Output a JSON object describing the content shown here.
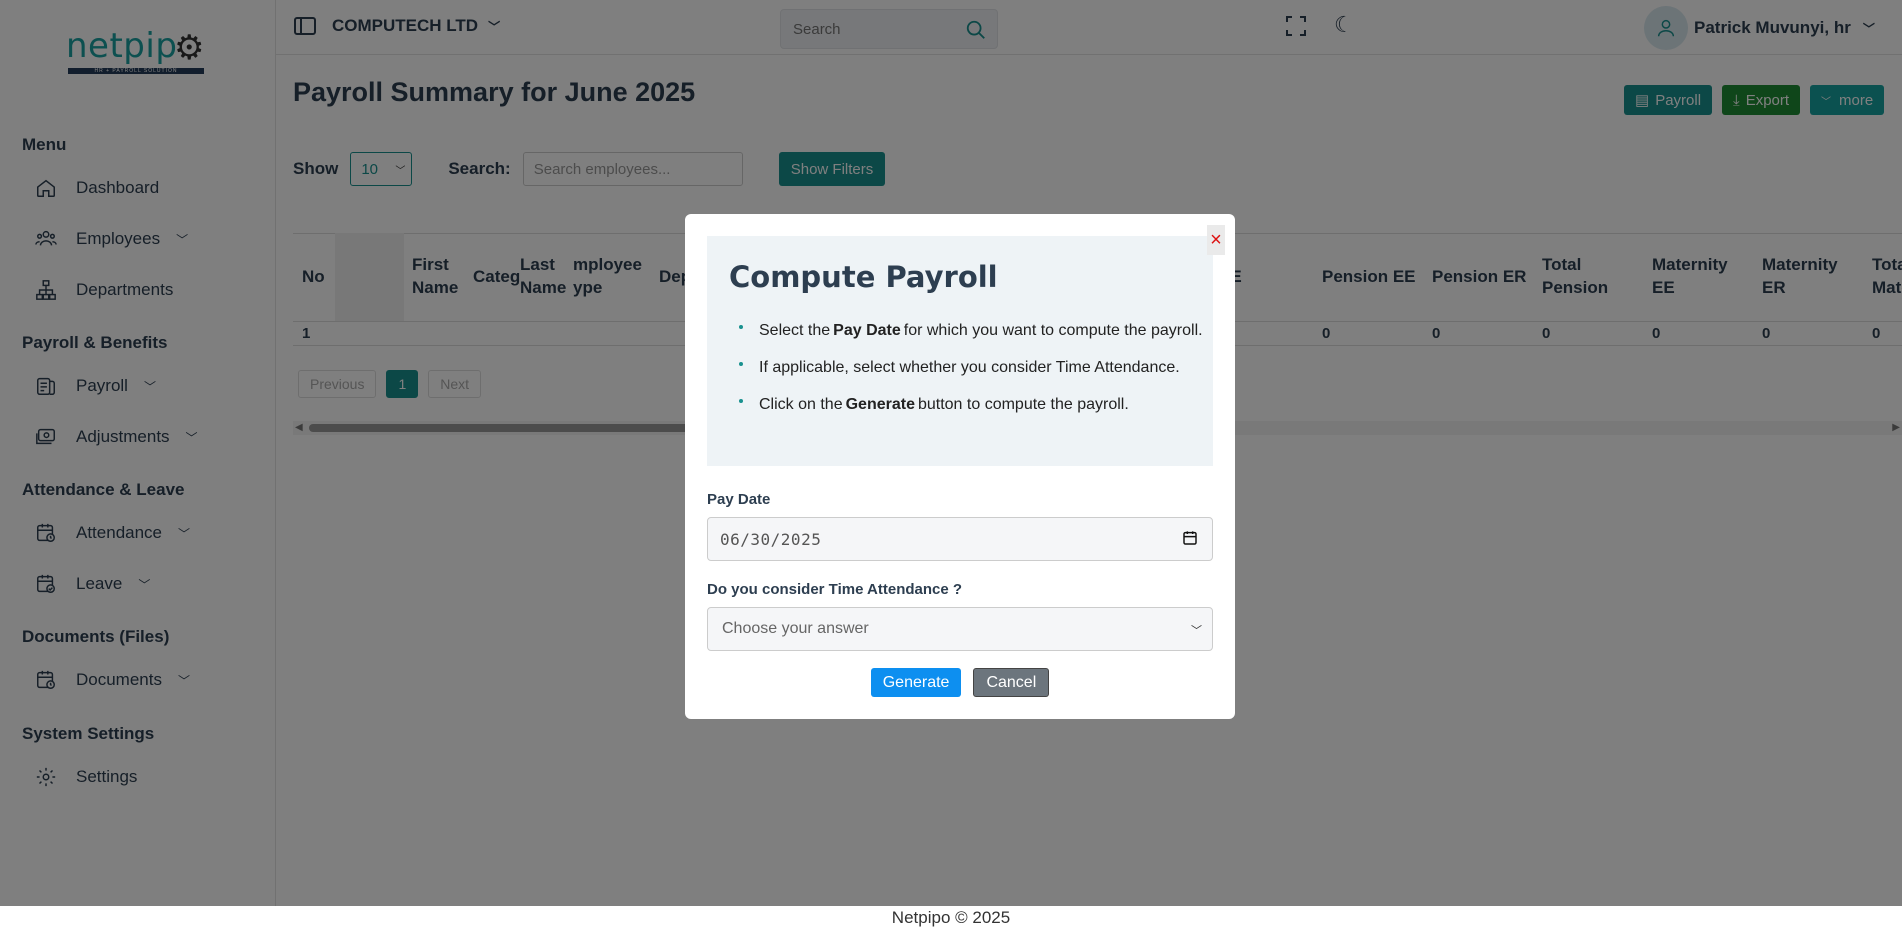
{
  "brand": {
    "logo_text": "netpip",
    "tagline": "HR + PAYROLL SOLUTION"
  },
  "sidebar": {
    "sections": [
      {
        "label": "Menu",
        "items": [
          {
            "label": "Dashboard"
          },
          {
            "label": "Employees"
          },
          {
            "label": "Departments"
          }
        ]
      },
      {
        "label": "Payroll & Benefits",
        "items": [
          {
            "label": "Payroll"
          },
          {
            "label": "Adjustments"
          }
        ]
      },
      {
        "label": "Attendance & Leave",
        "items": [
          {
            "label": "Attendance"
          },
          {
            "label": "Leave"
          }
        ]
      },
      {
        "label": "Documents (Files)",
        "items": [
          {
            "label": "Documents"
          }
        ]
      },
      {
        "label": "System Settings",
        "items": [
          {
            "label": "Settings"
          }
        ]
      }
    ]
  },
  "topbar": {
    "company": "COMPUTECH LTD",
    "search_placeholder": "Search",
    "user_name": "Patrick Muvunyi, hr"
  },
  "main": {
    "title": "Payroll Summary for June 2025",
    "buttons": {
      "payroll": "Payroll",
      "export": "Export",
      "more": "more"
    },
    "show_label": "Show",
    "page_size": "10",
    "search_label": "Search:",
    "search_placeholder": "Search employees...",
    "filters_button": "Show Filters",
    "table": {
      "headers": [
        "No",
        "",
        "First Name",
        "Categ",
        "Last Name",
        "mployee ype",
        "Dep",
        "YE",
        "Pension EE",
        "Pension ER",
        "Total Pension",
        "Maternity EE",
        "Maternity ER",
        "Tota Mate"
      ],
      "row": [
        "1",
        "0",
        "0",
        "0",
        "0",
        "0",
        "0"
      ]
    },
    "pagination": {
      "previous": "Previous",
      "current": "1",
      "next": "Next"
    }
  },
  "modal": {
    "title": "Compute Payroll",
    "close": "×",
    "instructions": [
      {
        "before": "Select the",
        "bold": "Pay Date",
        "after": "for which you want to compute the payroll."
      },
      {
        "before": "If applicable, select whether you consider Time Attendance.",
        "bold": "",
        "after": ""
      },
      {
        "before": "Click on the",
        "bold": "Generate",
        "after": "button to compute the payroll."
      }
    ],
    "pay_date_label": "Pay Date",
    "pay_date_value": "06/30/2025",
    "attendance_label": "Do you consider Time Attendance ?",
    "attendance_placeholder": "Choose your answer",
    "generate": "Generate",
    "cancel": "Cancel"
  },
  "footer": "Netpipo © 2025"
}
